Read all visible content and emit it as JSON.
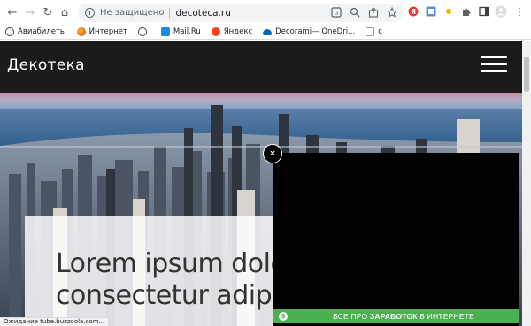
{
  "browser": {
    "nav": {
      "back": "←",
      "forward": "→",
      "reload": "↻",
      "home": "⌂"
    },
    "omnibox": {
      "security_text": "Не защищено",
      "url": "decoteca.ru"
    },
    "bookmarks": [
      {
        "label": "Авиабилеты",
        "icon_color": "#3c4043"
      },
      {
        "label": "Интернет",
        "icon_color": "#e8710a"
      },
      {
        "label": "",
        "icon_color": "#3c4043"
      },
      {
        "label": "Mail.Ru",
        "icon_color": "#168de2"
      },
      {
        "label": "Яндекс",
        "icon_color": "#fc3f1d"
      },
      {
        "label": "Decorami— OneDri...",
        "icon_color": "#0364b8"
      },
      {
        "label": "c",
        "icon_color": "#9aa0a6"
      }
    ],
    "status_text": "Ожидание tube.buzzoola.com..."
  },
  "site": {
    "logo": "Декотека",
    "hero_title": "Lorem ipsum dolo\nconsectetur adipis"
  },
  "ad": {
    "close_label": "×",
    "banner_prefix": "ВСЕ ПРО ",
    "banner_bold": "ЗАРАБОТОК",
    "banner_suffix": " В ИНТЕРНЕТЕ",
    "banner_icon": "$"
  },
  "colors": {
    "header_bg": "#1b1b1b",
    "ad_banner": "#4caf50",
    "ad_bg": "#000000"
  }
}
